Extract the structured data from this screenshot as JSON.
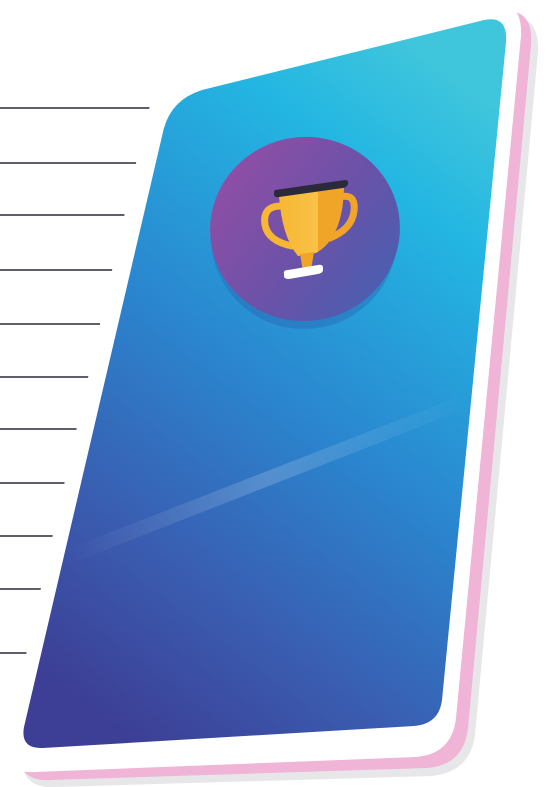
{
  "illustration": {
    "icon": "trophy-icon",
    "colors": {
      "screen_top": "#2fc0e0",
      "screen_mid": "#249ad8",
      "screen_bottom": "#3d3f94",
      "badge_top": "#8e4fa6",
      "badge_bottom": "#4a5aad",
      "trophy_gold": "#f7b733",
      "trophy_gold_dark": "#ef9a1e",
      "trophy_rim": "#2a2a3a",
      "shadow_pink": "#efb4d6",
      "speed_line": "#2a2a3a"
    }
  }
}
